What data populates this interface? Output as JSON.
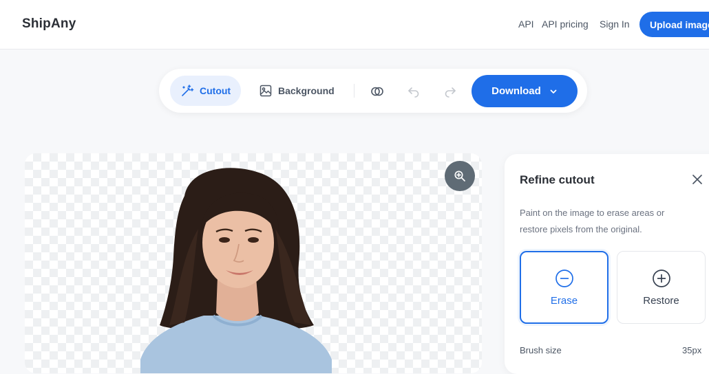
{
  "header": {
    "logo": "ShipAny",
    "nav": {
      "api": "API",
      "api_pricing": "API pricing",
      "sign_in": "Sign In"
    },
    "upload_label": "Upload image"
  },
  "toolbar": {
    "cutout_label": "Cutout",
    "background_label": "Background",
    "download_label": "Download",
    "icons": [
      "wand-icon",
      "image-icon",
      "compare-icon",
      "undo-icon",
      "redo-icon",
      "chevron-down-icon"
    ]
  },
  "canvas": {
    "zoom_icon": "zoom-in-icon",
    "subject": "portrait-photo"
  },
  "refine_panel": {
    "title": "Refine cutout",
    "description": "Paint on the image to erase areas or restore pixels from the original.",
    "modes": [
      {
        "label": "Erase",
        "icon": "minus-circle-icon",
        "selected": true
      },
      {
        "label": "Restore",
        "icon": "plus-circle-icon",
        "selected": false
      }
    ],
    "brush_size_label": "Brush size",
    "brush_size_value": "35px"
  },
  "colors": {
    "accent": "#1f6ee8",
    "accent_soft": "#e9f0fd",
    "text": "#2b2f36",
    "muted": "#6b7280"
  }
}
